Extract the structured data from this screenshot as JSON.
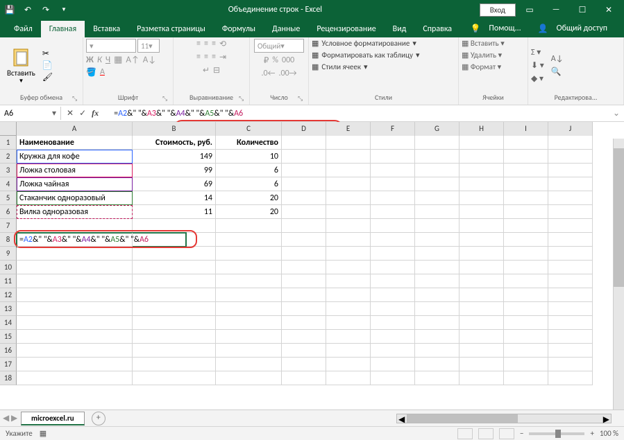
{
  "titlebar": {
    "title": "Объединение строк  -  Excel",
    "login": "Вход"
  },
  "menu": {
    "items": [
      "Файл",
      "Главная",
      "Вставка",
      "Разметка страницы",
      "Формулы",
      "Данные",
      "Рецензирование",
      "Вид",
      "Справка"
    ],
    "active_index": 1,
    "help_hint": "Помощ...",
    "share": "Общий доступ"
  },
  "ribbon": {
    "clipboard": {
      "paste": "Вставить",
      "label": "Буфер обмена"
    },
    "font": {
      "font_name": "",
      "font_size": "11",
      "label": "Шрифт"
    },
    "alignment": {
      "label": "Выравнивание"
    },
    "number": {
      "format": "Общий",
      "label": "Число"
    },
    "styles": {
      "conditional": "Условное форматирование",
      "table": "Форматировать как таблицу",
      "cell": "Стили ячеек",
      "label": "Стили"
    },
    "cells": {
      "insert": "Вставить",
      "delete": "Удалить",
      "format": "Формат",
      "label": "Ячейки"
    },
    "editing": {
      "label": "Редактирова..."
    }
  },
  "namebox": {
    "cell": "A6"
  },
  "formula": {
    "raw": "=A2&\" \"&A3&\" \"&A4&\" \"&A5&\" \"&A6",
    "parts": [
      {
        "t": "=",
        "c": "black"
      },
      {
        "t": "A2",
        "c": "blue"
      },
      {
        "t": "&\" \"&",
        "c": "black"
      },
      {
        "t": "A3",
        "c": "red"
      },
      {
        "t": "&\" \"&",
        "c": "black"
      },
      {
        "t": "A4",
        "c": "purple"
      },
      {
        "t": "&\" \"&",
        "c": "black"
      },
      {
        "t": "A5",
        "c": "green"
      },
      {
        "t": "&\" \"&",
        "c": "black"
      },
      {
        "t": "A6",
        "c": "pink"
      }
    ]
  },
  "columns": [
    "A",
    "B",
    "C",
    "D",
    "E",
    "F",
    "G",
    "H",
    "I",
    "J"
  ],
  "rows_shown": 18,
  "table": {
    "headers": [
      "Наименование",
      "Стоимость, руб.",
      "Количество"
    ],
    "data": [
      [
        "Кружка для кофе",
        149,
        10
      ],
      [
        "Ложка столовая",
        99,
        6
      ],
      [
        "Ложка чайная",
        69,
        6
      ],
      [
        "Стаканчик одноразовый",
        14,
        20
      ],
      [
        "Вилка одноразовая",
        11,
        20
      ]
    ]
  },
  "sheet": {
    "name": "microexcel.ru"
  },
  "status": {
    "mode": "Укажите",
    "zoom": "100 %"
  }
}
